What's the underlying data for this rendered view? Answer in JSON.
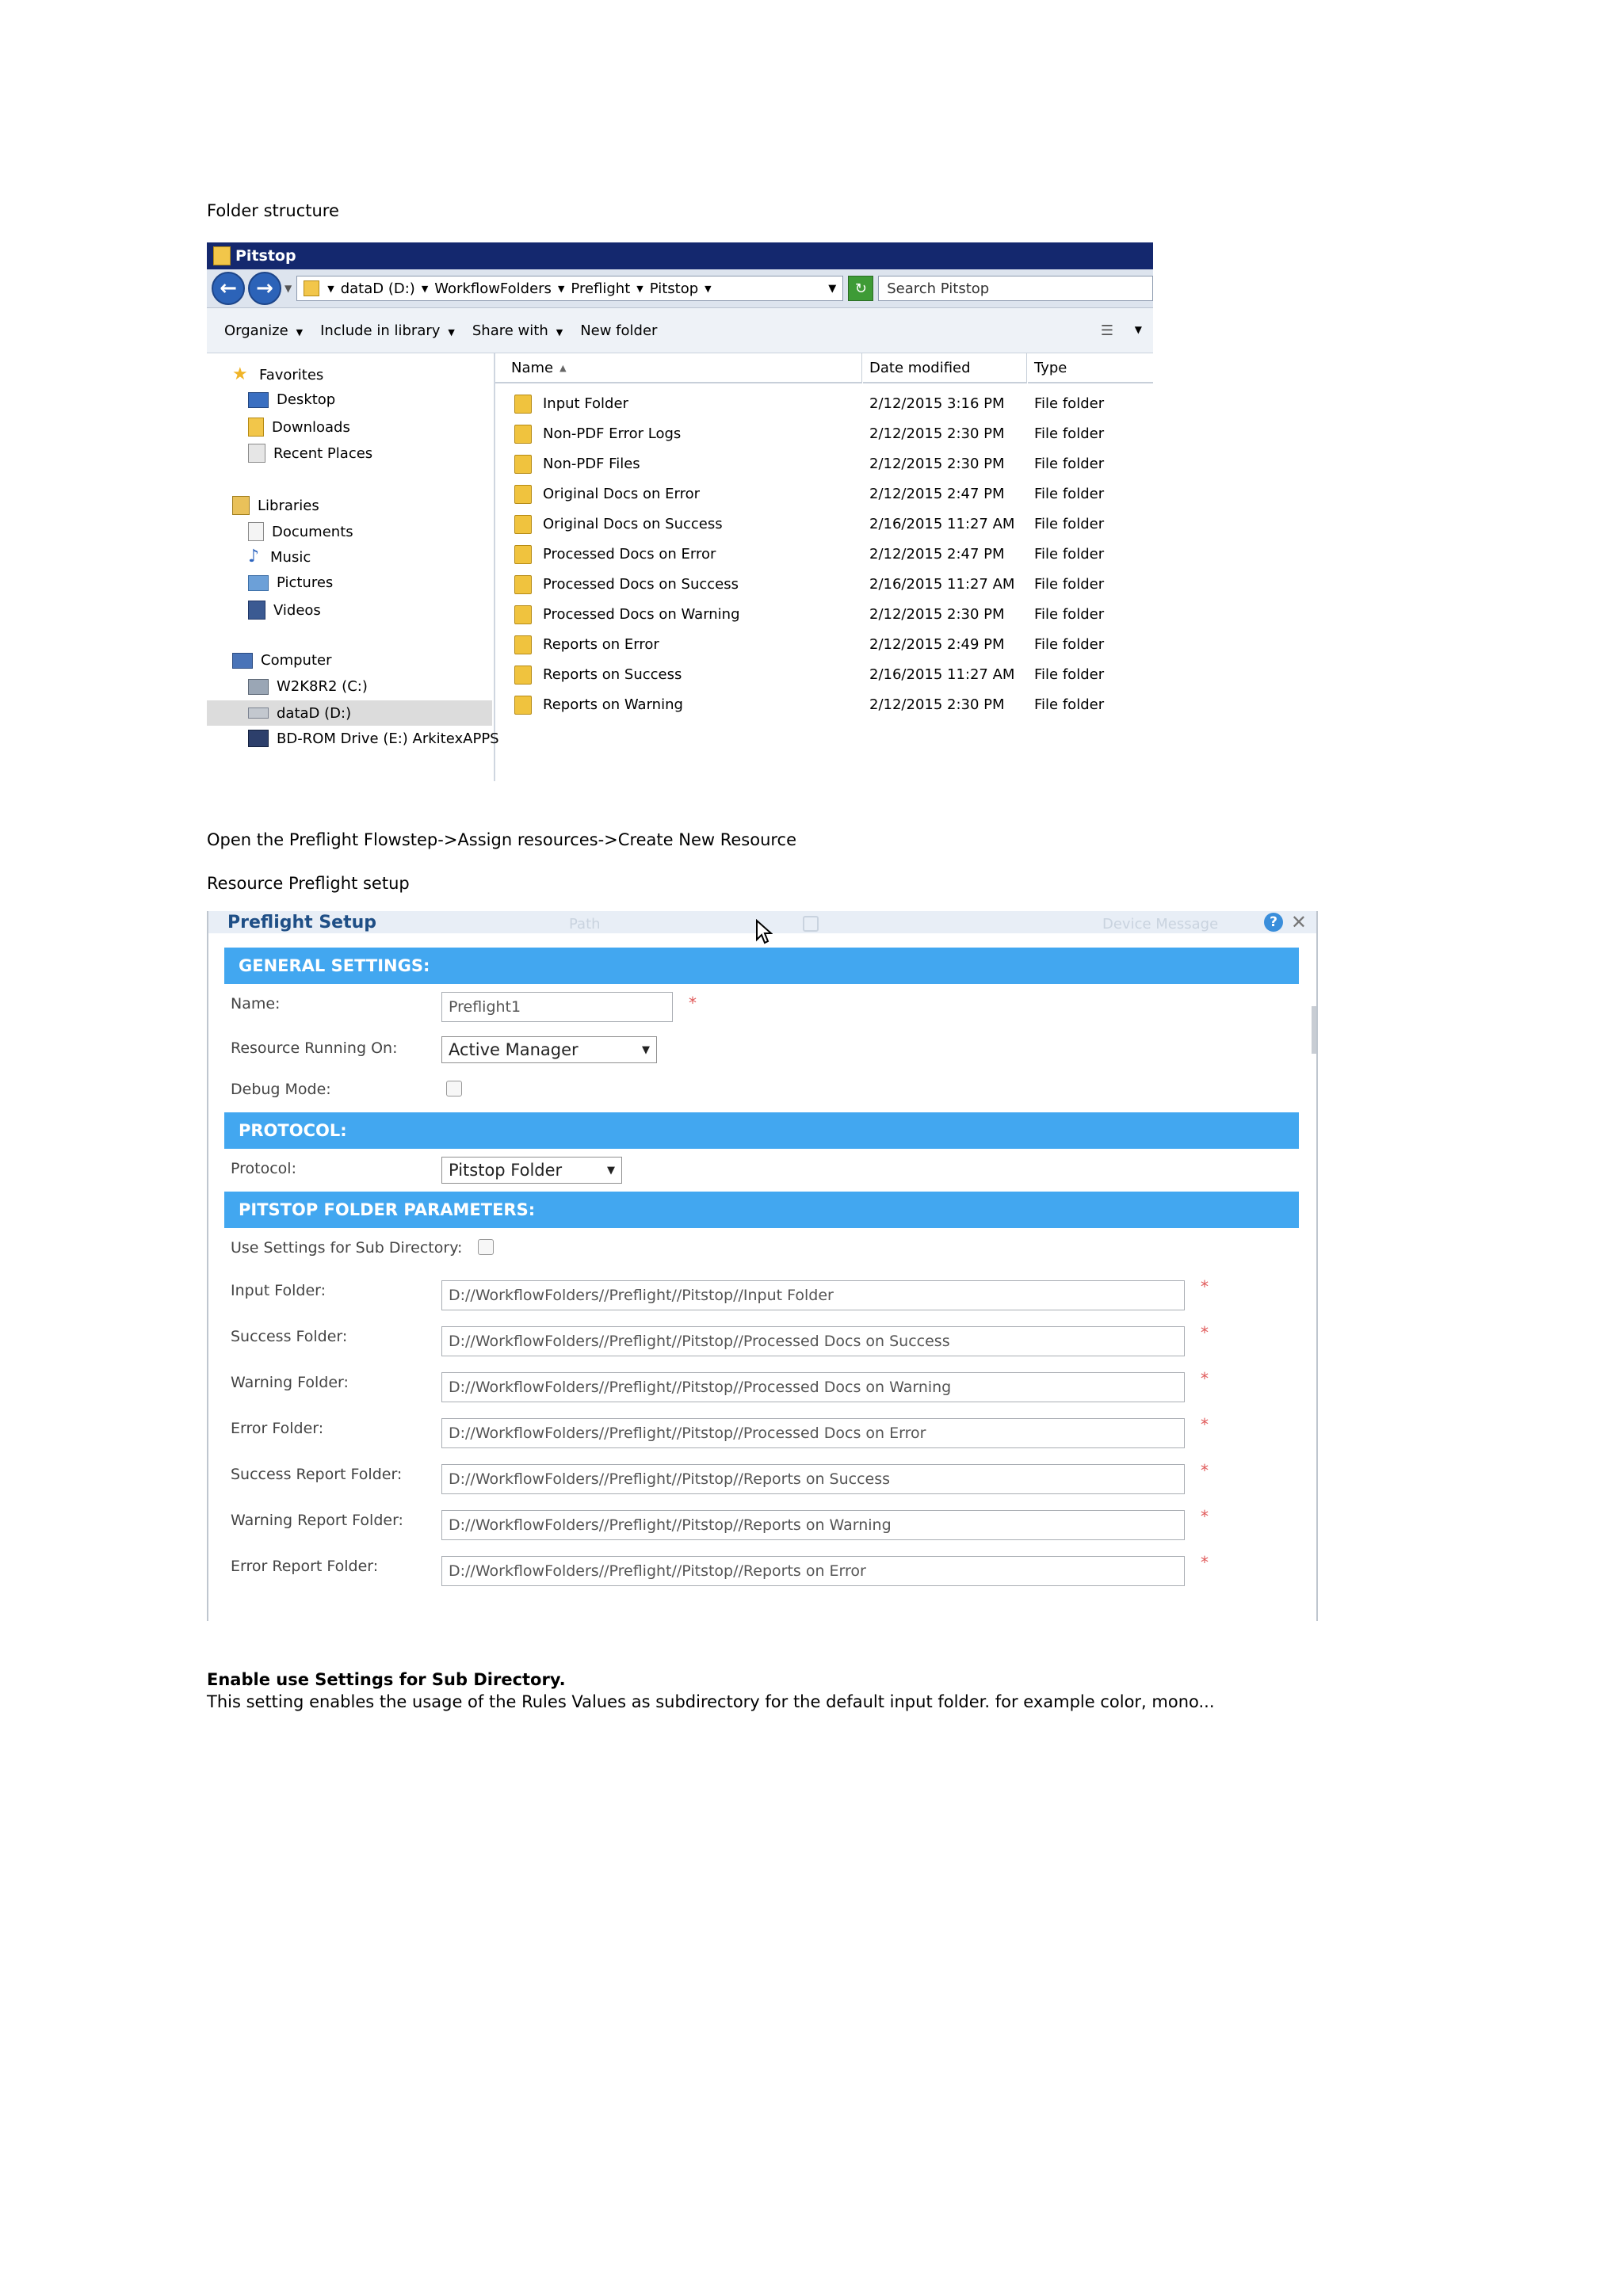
{
  "doc": {
    "folder_structure_caption": "Folder structure",
    "open_instruction": "Open the Preflight Flowstep->Assign resources->Create New Resource",
    "resource_caption": "Resource Preflight setup",
    "enable_heading": "Enable use Settings for Sub Directory.",
    "enable_description": "This setting enables the usage of the Rules Values as subdirectory for the default input folder. for example color, mono..."
  },
  "explorer": {
    "title": "Pitstop",
    "breadcrumbs": [
      "dataD (D:)",
      "WorkflowFolders",
      "Preflight",
      "Pitstop"
    ],
    "search_placeholder": "Search Pitstop",
    "toolbar": {
      "organize": "Organize",
      "include_in_library": "Include in library",
      "share_with": "Share with",
      "new_folder": "New folder"
    },
    "nav": {
      "favorites": "Favorites",
      "desktop": "Desktop",
      "downloads": "Downloads",
      "recent_places": "Recent Places",
      "libraries": "Libraries",
      "documents": "Documents",
      "music": "Music",
      "pictures": "Pictures",
      "videos": "Videos",
      "computer": "Computer",
      "drive_c": "W2K8R2 (C:)",
      "drive_d": "dataD (D:)",
      "drive_e": "BD-ROM Drive (E:) ArkitexAPPS"
    },
    "columns": {
      "name": "Name",
      "date_modified": "Date modified",
      "type": "Type"
    },
    "files": [
      {
        "name": "Input Folder",
        "date": "2/12/2015 3:16 PM",
        "type": "File folder"
      },
      {
        "name": "Non-PDF Error Logs",
        "date": "2/12/2015 2:30 PM",
        "type": "File folder"
      },
      {
        "name": "Non-PDF Files",
        "date": "2/12/2015 2:30 PM",
        "type": "File folder"
      },
      {
        "name": "Original Docs on Error",
        "date": "2/12/2015 2:47 PM",
        "type": "File folder"
      },
      {
        "name": "Original Docs on Success",
        "date": "2/16/2015 11:27 AM",
        "type": "File folder"
      },
      {
        "name": "Processed Docs on Error",
        "date": "2/12/2015 2:47 PM",
        "type": "File folder"
      },
      {
        "name": "Processed Docs on Success",
        "date": "2/16/2015 11:27 AM",
        "type": "File folder"
      },
      {
        "name": "Processed Docs on Warning",
        "date": "2/12/2015 2:30 PM",
        "type": "File folder"
      },
      {
        "name": "Reports on Error",
        "date": "2/12/2015 2:49 PM",
        "type": "File folder"
      },
      {
        "name": "Reports on Success",
        "date": "2/16/2015 11:27 AM",
        "type": "File folder"
      },
      {
        "name": "Reports on Warning",
        "date": "2/12/2015 2:30 PM",
        "type": "File folder"
      }
    ]
  },
  "dialog": {
    "title": "Preflight Setup",
    "ghost_path": "Path",
    "ghost_device_message": "Device Message",
    "general_settings": "GENERAL SETTINGS:",
    "name_label": "Name:",
    "name_value": "Preflight1",
    "running_on_label": "Resource Running On:",
    "running_on_value": "Active Manager",
    "debug_label": "Debug Mode:",
    "protocol_section": "PROTOCOL:",
    "protocol_label": "Protocol:",
    "protocol_value": "Pitstop Folder",
    "pitstop_section": "PITSTOP FOLDER PARAMETERS:",
    "use_sub_dir_label": "Use Settings for Sub Directory:",
    "required_mark": "*",
    "folders": [
      {
        "label": "Input Folder:",
        "value": "D://WorkflowFolders//Preflight//Pitstop//Input Folder"
      },
      {
        "label": "Success Folder:",
        "value": "D://WorkflowFolders//Preflight//Pitstop//Processed Docs on Success"
      },
      {
        "label": "Warning Folder:",
        "value": "D://WorkflowFolders//Preflight//Pitstop//Processed Docs on Warning"
      },
      {
        "label": "Error Folder:",
        "value": "D://WorkflowFolders//Preflight//Pitstop//Processed Docs on Error"
      },
      {
        "label": "Success Report Folder:",
        "value": "D://WorkflowFolders//Preflight//Pitstop//Reports on Success"
      },
      {
        "label": "Warning Report Folder:",
        "value": "D://WorkflowFolders//Preflight//Pitstop//Reports on Warning"
      },
      {
        "label": "Error Report Folder:",
        "value": "D://WorkflowFolders//Preflight//Pitstop//Reports on Error"
      }
    ]
  }
}
